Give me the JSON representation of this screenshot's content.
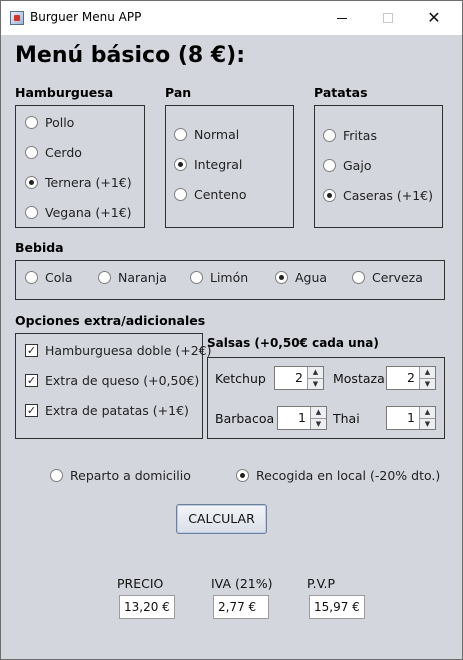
{
  "window": {
    "title": "Burguer Menu APP",
    "minimize_glyph": "",
    "close_glyph": "✕"
  },
  "heading": "Menú básico (8 €):",
  "hamburguesa": {
    "title": "Hamburguesa",
    "options": [
      {
        "label": "Pollo",
        "selected": false
      },
      {
        "label": "Cerdo",
        "selected": false
      },
      {
        "label": "Ternera (+1€)",
        "selected": true
      },
      {
        "label": "Vegana (+1€)",
        "selected": false
      }
    ]
  },
  "pan": {
    "title": "Pan",
    "options": [
      {
        "label": "Normal",
        "selected": false
      },
      {
        "label": "Integral",
        "selected": true
      },
      {
        "label": "Centeno",
        "selected": false
      }
    ]
  },
  "patatas": {
    "title": "Patatas",
    "options": [
      {
        "label": "Fritas",
        "selected": false
      },
      {
        "label": "Gajo",
        "selected": false
      },
      {
        "label": "Caseras (+1€)",
        "selected": true
      }
    ]
  },
  "bebida": {
    "title": "Bebida",
    "options": [
      {
        "label": "Cola",
        "selected": false
      },
      {
        "label": "Naranja",
        "selected": false
      },
      {
        "label": "Limón",
        "selected": false
      },
      {
        "label": "Agua",
        "selected": true
      },
      {
        "label": "Cerveza",
        "selected": false
      }
    ]
  },
  "extras": {
    "title": "Opciones extra/adicionales",
    "options": [
      {
        "label": "Hamburguesa doble (+2€)",
        "checked": true
      },
      {
        "label": "Extra de queso (+0,50€)",
        "checked": true
      },
      {
        "label": "Extra de patatas (+1€)",
        "checked": true
      }
    ]
  },
  "salsas": {
    "title": "Salsas (+0,50€ cada una)",
    "items": [
      {
        "label": "Ketchup",
        "value": "2"
      },
      {
        "label": "Mostaza",
        "value": "2"
      },
      {
        "label": "Barbacoa",
        "value": "1"
      },
      {
        "label": "Thai",
        "value": "1"
      }
    ]
  },
  "entrega": {
    "options": [
      {
        "label": "Reparto a domicilio",
        "selected": false
      },
      {
        "label": "Recogida en local (-20% dto.)",
        "selected": true
      }
    ]
  },
  "calcular_label": "CALCULAR",
  "resultados": {
    "precio_label": "PRECIO",
    "precio_value": "13,20 €",
    "iva_label": "IVA (21%)",
    "iva_value": "2,77 €",
    "pvp_label": "P.V.P",
    "pvp_value": "15,97 €"
  }
}
